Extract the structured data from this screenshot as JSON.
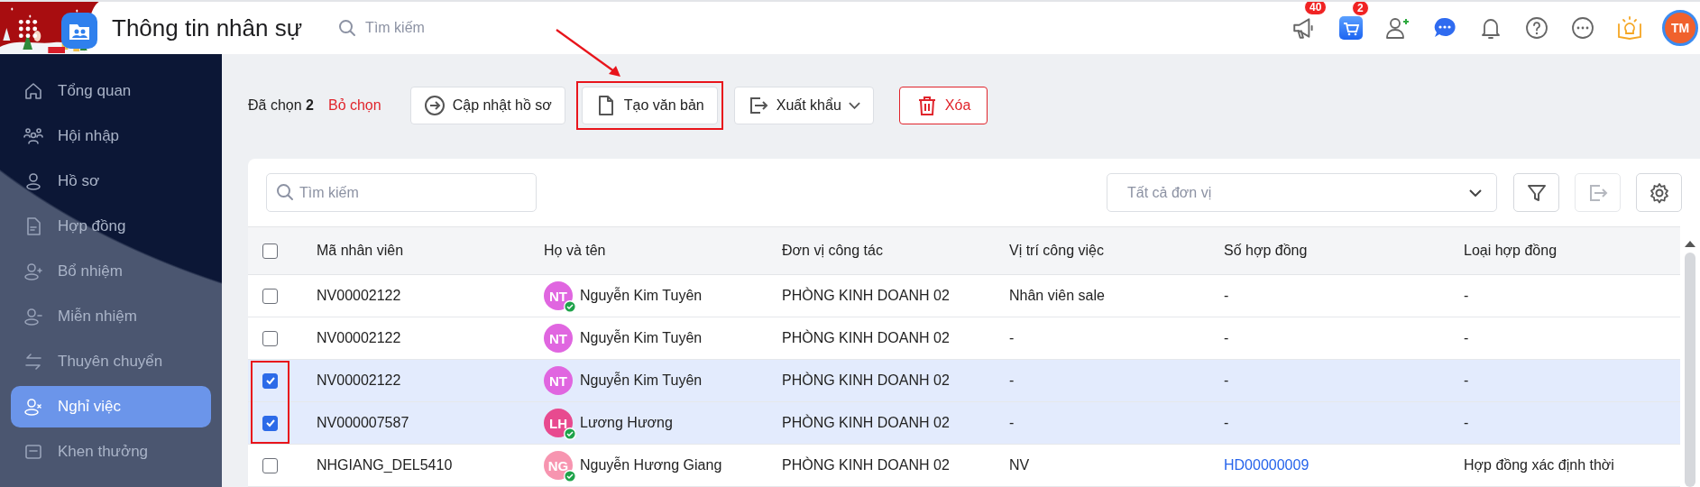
{
  "header": {
    "title": "Thông tin nhân sự",
    "search": {
      "placeholder": "Tìm kiếm"
    },
    "icons": [
      {
        "kind": "megaphone",
        "badge": "40"
      },
      {
        "kind": "cart",
        "badge": "2"
      },
      {
        "kind": "user-add"
      },
      {
        "kind": "chat"
      },
      {
        "kind": "bell"
      },
      {
        "kind": "help"
      },
      {
        "kind": "more"
      },
      {
        "kind": "bulb"
      }
    ],
    "avatar": "TM"
  },
  "sidebar": {
    "items": [
      {
        "label": "Tổng quan",
        "selected": false
      },
      {
        "label": "Hội nhập",
        "selected": false
      },
      {
        "label": "Hồ sơ",
        "selected": false
      },
      {
        "label": "Hợp đồng",
        "selected": false
      },
      {
        "label": "Bổ nhiệm",
        "selected": false
      },
      {
        "label": "Miễn nhiệm",
        "selected": false
      },
      {
        "label": "Thuyên chuyển",
        "selected": false
      },
      {
        "label": "Nghỉ việc",
        "selected": true
      },
      {
        "label": "Khen thưởng",
        "selected": false
      }
    ]
  },
  "selection": {
    "text": "Đã chọn **2**",
    "clear": "Bỏ chọn"
  },
  "actions": [
    {
      "label": "Cập nhật hồ sơ",
      "kind": "update",
      "highlighted": false
    },
    {
      "label": "Tạo văn bản",
      "kind": "document",
      "highlighted": true
    },
    {
      "label": "Xuất khẩu",
      "kind": "export",
      "highlighted": false
    },
    {
      "label": "Xóa",
      "kind": "delete",
      "highlighted": false
    }
  ],
  "table": {
    "search": {
      "placeholder": "Tìm kiếm"
    },
    "unit_filter": {
      "placeholder": "Tất cả đơn vị"
    },
    "tools": [
      {
        "kind": "filter",
        "disabled": false
      },
      {
        "kind": "export",
        "disabled": true
      },
      {
        "kind": "settings",
        "disabled": false
      }
    ],
    "select_all": {
      "checked": false
    },
    "highlight_checked": true,
    "columns": [
      "Mã nhân viên",
      "Họ và tên",
      "Đơn vị công tác",
      "Vị trí công việc",
      "Số hợp đồng",
      "Loại hợp đồng"
    ],
    "rows": [
      {
        "checked": false,
        "code": "NV00002122",
        "initials": "NT",
        "color": "#e066e0",
        "verified": true,
        "name": "Nguyễn Kim Tuyên",
        "unit": "PHÒNG KINH DOANH 02",
        "position": "Nhân viên sale",
        "contract_no": "-",
        "contract_link": false,
        "contract_type": "-"
      },
      {
        "checked": false,
        "code": "NV00002122",
        "initials": "NT",
        "color": "#e066e0",
        "verified": false,
        "name": "Nguyễn Kim Tuyên",
        "unit": "PHÒNG KINH DOANH 02",
        "position": "-",
        "contract_no": "-",
        "contract_link": false,
        "contract_type": "-"
      },
      {
        "checked": true,
        "code": "NV00002122",
        "initials": "NT",
        "color": "#e066e0",
        "verified": false,
        "name": "Nguyễn Kim Tuyên",
        "unit": "PHÒNG KINH DOANH 02",
        "position": "-",
        "contract_no": "-",
        "contract_link": false,
        "contract_type": "-"
      },
      {
        "checked": true,
        "code": "NV000007587",
        "initials": "LH",
        "color": "#e84a8f",
        "verified": true,
        "name": "Lương Hương",
        "unit": "PHÒNG KINH DOANH 02",
        "position": "-",
        "contract_no": "-",
        "contract_link": false,
        "contract_type": "-"
      },
      {
        "checked": false,
        "code": "NHGIANG_DEL5410",
        "initials": "NG",
        "color": "#f795b0",
        "verified": true,
        "name": "Nguyễn Hương Giang",
        "unit": "PHÒNG KINH DOANH 02",
        "position": "NV",
        "contract_no": "HD00000009",
        "contract_link": true,
        "contract_type": "Hợp đồng xác định thời"
      }
    ]
  }
}
